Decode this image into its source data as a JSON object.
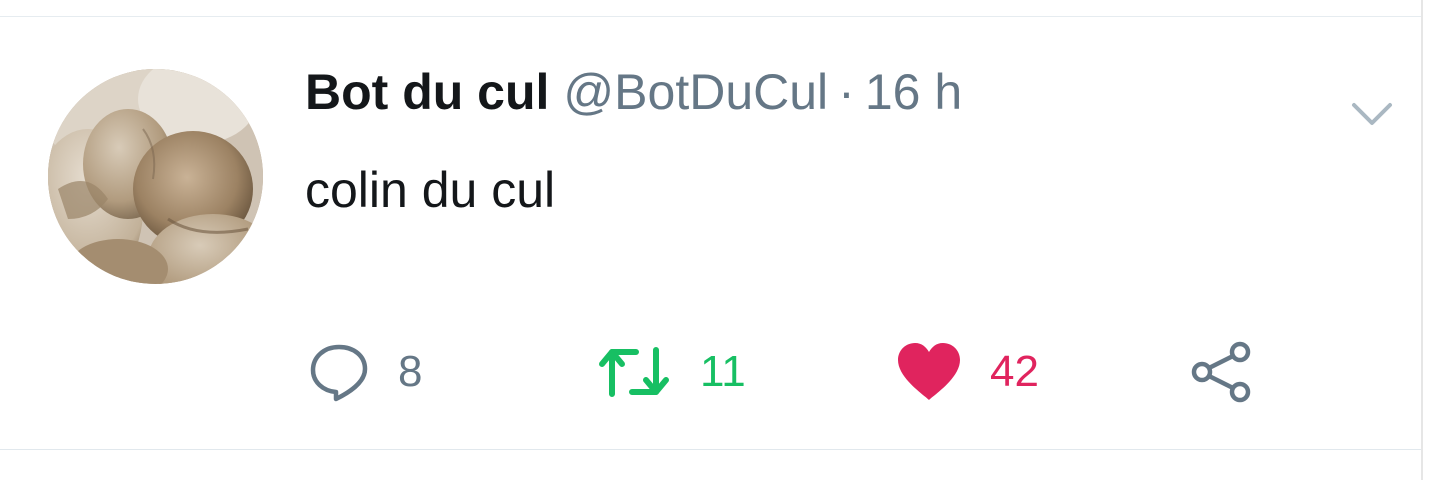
{
  "tweet": {
    "author_name": "Bot du cul",
    "author_handle": "@BotDuCul",
    "separator": "·",
    "timestamp": "16 h",
    "text": "colin du cul"
  },
  "actions": {
    "reply_count": "8",
    "retweet_count": "11",
    "like_count": "42"
  },
  "icons": {
    "menu": "chevron-down-icon",
    "reply": "speech-bubble-icon",
    "retweet": "retweet-arrows-icon",
    "like": "heart-icon",
    "share": "share-nodes-icon"
  },
  "colors": {
    "text_primary": "#14171a",
    "text_secondary": "#657786",
    "retweet_active": "#17bf63",
    "like_active": "#e0245e",
    "divider": "#e6ecf0"
  }
}
